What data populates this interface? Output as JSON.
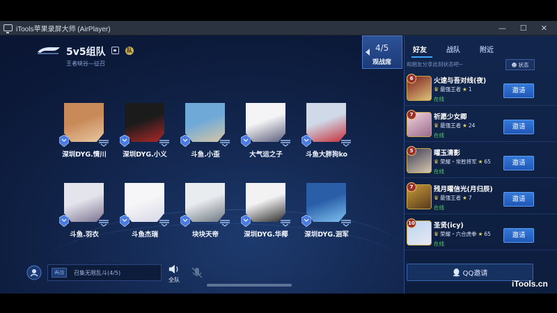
{
  "window": {
    "title": "iTools苹果录屏大师 (AirPlayer)",
    "controls": {
      "minimize": "—",
      "maximize": "☐",
      "close": "✕"
    }
  },
  "mode": {
    "title": "5v5组队",
    "subtitle": "王者峡谷—征召"
  },
  "spectate": {
    "count": "4/5",
    "label": "观战席"
  },
  "players": [
    {
      "name": "深圳DYG.情川",
      "avatar_colors": [
        "#c98a5a",
        "#e8c7a1"
      ],
      "rank_color": "#4a7be0"
    },
    {
      "name": "深圳DYG.小义",
      "avatar_colors": [
        "#1b1b1b",
        "#b02828"
      ],
      "rank_color": "#4a7be0"
    },
    {
      "name": "斗鱼.小歪",
      "avatar_colors": [
        "#6fa9d8",
        "#d7c6a7"
      ],
      "rank_color": "#4a7be0"
    },
    {
      "name": "大气运之子",
      "avatar_colors": [
        "#f4f4f6",
        "#5b5e7a"
      ],
      "rank_color": "#4a7be0"
    },
    {
      "name": "斗鱼大胖狗ko",
      "avatar_colors": [
        "#cfd9e8",
        "#c62f3a"
      ],
      "rank_color": "#4a7be0"
    },
    {
      "name": "斗鱼.羽衣",
      "avatar_colors": [
        "#e4e4ec",
        "#7c7390"
      ],
      "rank_color": "#4a7be0"
    },
    {
      "name": "斗鱼杰瑞",
      "avatar_colors": [
        "#f6f6f8",
        "#d7d7e8"
      ],
      "rank_color": "#4a7be0"
    },
    {
      "name": "块块天帝",
      "avatar_colors": [
        "#e9ecef",
        "#6d7680"
      ],
      "rank_color": "#4a7be0"
    },
    {
      "name": "深圳DYG.华椰",
      "avatar_colors": [
        "#f2f2f2",
        "#2b2b2b"
      ],
      "rank_color": "#4a7be0"
    },
    {
      "name": "深圳DYG.洄军",
      "avatar_colors": [
        "#2a5fa8",
        "#7ec1f0"
      ],
      "rank_color": "#4a7be0"
    }
  ],
  "chat": {
    "channel": "再战",
    "placeholder": "召集无限乱斗(4/5)",
    "speaker_label": "全队"
  },
  "friends_panel": {
    "tabs": [
      "好友",
      "战队",
      "附近"
    ],
    "active_tab": 0,
    "status_placeholder": "和朋友分享此刻状态吧~",
    "status_button": "状态",
    "invite_label": "邀请",
    "qq_invite": "QQ邀请",
    "friends": [
      {
        "level": "6",
        "name": "火速与吾对线(夜)",
        "rank": "最强王者",
        "stars": "1",
        "status": "在线",
        "avatar_colors": [
          "#7a1d1d",
          "#e0c37a"
        ]
      },
      {
        "level": "7",
        "name": "祈愿少女卿",
        "rank": "最强王者",
        "stars": "24",
        "status": "在线",
        "avatar_colors": [
          "#f2d4e0",
          "#9a6b8a"
        ]
      },
      {
        "level": "5",
        "name": "曜玉清影",
        "rank": "荣耀・常胜将军",
        "stars": "65",
        "status": "在线",
        "avatar_colors": [
          "#3b3b55",
          "#d9c9b0"
        ]
      },
      {
        "level": "7",
        "name": "残月曜信光(月归辰)",
        "rank": "最强王者",
        "stars": "7",
        "status": "在线",
        "avatar_colors": [
          "#c79b3a",
          "#5a3a1a"
        ]
      },
      {
        "level": "10",
        "name": "圣贤(icy)",
        "rank": "荣耀・六合虎拳",
        "stars": "65",
        "status": "在线",
        "avatar_colors": [
          "#b8d4f0",
          "#e9e9f4"
        ]
      }
    ]
  },
  "watermark": "iTools.cn"
}
